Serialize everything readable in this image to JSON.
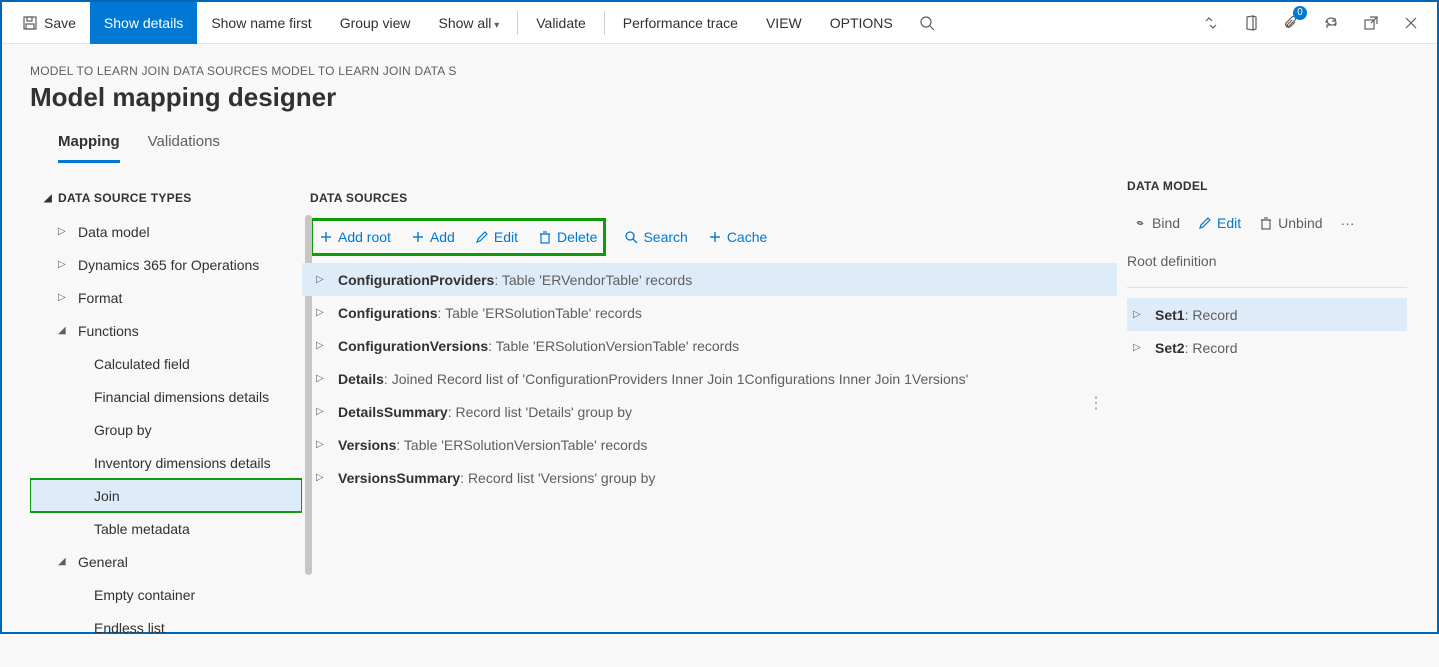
{
  "cmdbar": {
    "save": "Save",
    "show_details": "Show details",
    "show_name_first": "Show name first",
    "group_view": "Group view",
    "show_all": "Show all",
    "validate": "Validate",
    "perf_trace": "Performance trace",
    "view": "VIEW",
    "options": "OPTIONS",
    "badge_count": "0"
  },
  "breadcrumb": "MODEL TO LEARN JOIN DATA SOURCES MODEL TO LEARN JOIN DATA S",
  "page_title": "Model mapping designer",
  "tabs": {
    "mapping": "Mapping",
    "validations": "Validations"
  },
  "left": {
    "heading": "DATA SOURCE TYPES",
    "items": [
      {
        "label": "Data model",
        "level": 1,
        "expander": "▷"
      },
      {
        "label": "Dynamics 365 for Operations",
        "level": 1,
        "expander": "▷"
      },
      {
        "label": "Format",
        "level": 1,
        "expander": "▷"
      },
      {
        "label": "Functions",
        "level": 1,
        "expander": "◢"
      },
      {
        "label": "Calculated field",
        "level": 2,
        "expander": ""
      },
      {
        "label": "Financial dimensions details",
        "level": 2,
        "expander": ""
      },
      {
        "label": "Group by",
        "level": 2,
        "expander": ""
      },
      {
        "label": "Inventory dimensions details",
        "level": 2,
        "expander": ""
      },
      {
        "label": "Join",
        "level": 2,
        "expander": "",
        "selected": true,
        "green": true
      },
      {
        "label": "Table metadata",
        "level": 2,
        "expander": ""
      },
      {
        "label": "General",
        "level": 1,
        "expander": "◢"
      },
      {
        "label": "Empty container",
        "level": 2,
        "expander": ""
      },
      {
        "label": "Endless list",
        "level": 2,
        "expander": ""
      }
    ]
  },
  "center": {
    "heading": "DATA SOURCES",
    "actions": {
      "add_root": "Add root",
      "add": "Add",
      "edit": "Edit",
      "delete": "Delete",
      "search": "Search",
      "cache": "Cache"
    },
    "items": [
      {
        "name": "ConfigurationProviders",
        "desc": ": Table 'ERVendorTable' records",
        "selected": true
      },
      {
        "name": "Configurations",
        "desc": ": Table 'ERSolutionTable' records"
      },
      {
        "name": "ConfigurationVersions",
        "desc": ": Table 'ERSolutionVersionTable' records"
      },
      {
        "name": "Details",
        "desc": ": Joined Record list of 'ConfigurationProviders Inner Join 1Configurations Inner Join 1Versions'"
      },
      {
        "name": "DetailsSummary",
        "desc": ": Record list 'Details' group by"
      },
      {
        "name": "Versions",
        "desc": ": Table 'ERSolutionVersionTable' records"
      },
      {
        "name": "VersionsSummary",
        "desc": ": Record list 'Versions' group by"
      }
    ]
  },
  "right": {
    "heading": "DATA MODEL",
    "actions": {
      "bind": "Bind",
      "edit": "Edit",
      "unbind": "Unbind"
    },
    "root_label": "Root definition",
    "items": [
      {
        "name": "Set1",
        "desc": ": Record",
        "selected": true
      },
      {
        "name": "Set2",
        "desc": ": Record"
      }
    ]
  }
}
